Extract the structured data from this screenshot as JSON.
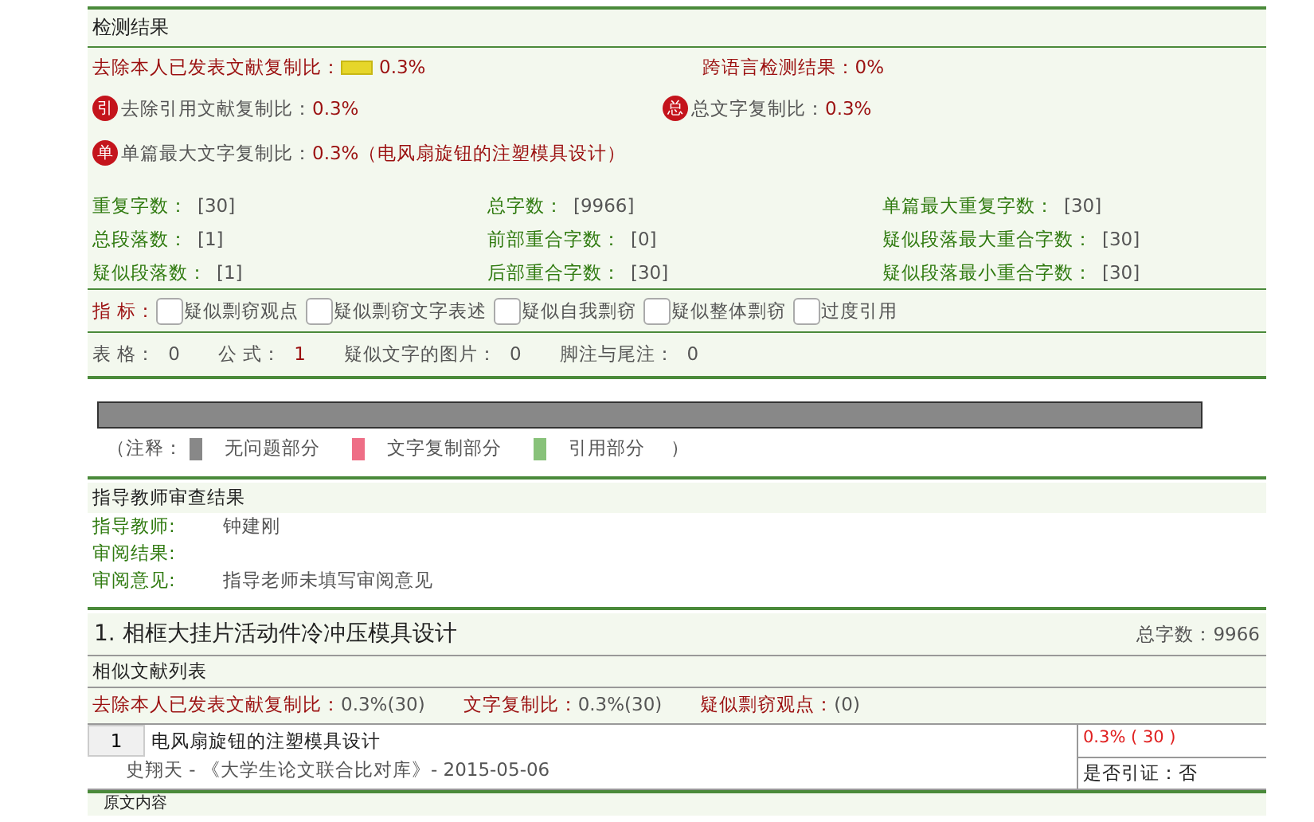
{
  "detection": {
    "title": "检测结果",
    "ratio_row": {
      "label": "去除本人已发表文献复制比：",
      "value": "0.3%",
      "cross_label": "跨语言检测结果：",
      "cross_value": "0%"
    },
    "badge_row": [
      {
        "badge": "引",
        "label": "去除引用文献复制比：",
        "value": "0.3%"
      },
      {
        "badge": "总",
        "label": "总文字复制比：",
        "value": "0.3%"
      }
    ],
    "single": {
      "badge": "单",
      "label": "单篇最大文字复制比：",
      "value": "0.3%（电风扇旋钮的注塑模具设计）"
    },
    "stats": [
      {
        "label": "重复字数：",
        "value": "[30]"
      },
      {
        "label": "总字数：",
        "value": "[9966]"
      },
      {
        "label": "单篇最大重复字数：",
        "value": "[30]"
      },
      {
        "label": "总段落数：",
        "value": "[1]"
      },
      {
        "label": "前部重合字数：",
        "value": "[0]"
      },
      {
        "label": "疑似段落最大重合字数：",
        "value": "[30]"
      },
      {
        "label": "疑似段落数：",
        "value": "[1]"
      },
      {
        "label": "后部重合字数：",
        "value": "[30]"
      },
      {
        "label": "疑似段落最小重合字数：",
        "value": "[30]"
      }
    ],
    "indicator_label": "指 标：",
    "indicators": [
      {
        "label": "疑似剽窃观点",
        "checked": false
      },
      {
        "label": "疑似剽窃文字表述",
        "checked": false
      },
      {
        "label": "疑似自我剽窃",
        "checked": false
      },
      {
        "label": "疑似整体剽窃",
        "checked": false
      },
      {
        "label": "过度引用",
        "checked": false
      }
    ],
    "counts": [
      {
        "label": "表 格：",
        "value": "0",
        "highlight": false
      },
      {
        "label": "公 式：",
        "value": "1",
        "highlight": true
      },
      {
        "label": "疑似文字的图片：",
        "value": "0",
        "highlight": false
      },
      {
        "label": "脚注与尾注：",
        "value": "0",
        "highlight": false
      }
    ],
    "legend_open": "（注释：",
    "legend": [
      {
        "label": "无问题部分",
        "color": "#888888"
      },
      {
        "label": "文字复制部分",
        "color": "#ee6e86"
      },
      {
        "label": "引用部分",
        "color": "#88c27a"
      }
    ],
    "legend_close": "）"
  },
  "review": {
    "title": "指导教师审查结果",
    "rows": [
      {
        "label": "指导教师:",
        "value": "钟建刚"
      },
      {
        "label": "审阅结果:",
        "value": ""
      },
      {
        "label": "审阅意见:",
        "value": "指导老师未填写审阅意见"
      }
    ]
  },
  "document": {
    "title": "1. 相框大挂片活动件冷冲压模具设计",
    "total": "总字数：9966",
    "list_title": "相似文献列表",
    "ratios": [
      {
        "label": "去除本人已发表文献复制比：",
        "value": "0.3%(30)"
      },
      {
        "label": "文字复制比：",
        "value": "0.3%(30)"
      },
      {
        "label": "疑似剽窃观点：",
        "value": "(0)"
      }
    ],
    "entries": [
      {
        "index": "1",
        "title": "电风扇旋钮的注塑模具设计",
        "source": "史翔天 - 《大学生论文联合比对库》- 2015-05-06",
        "ratio": "0.3% ( 30 )",
        "cited": "是否引证：否"
      }
    ],
    "next_section": "原文内容"
  }
}
